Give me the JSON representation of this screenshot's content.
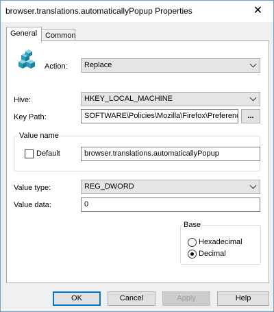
{
  "window": {
    "title": "browser.translations.automaticallyPopup Properties"
  },
  "tabs": [
    {
      "label": "General"
    },
    {
      "label": "Common"
    }
  ],
  "action": {
    "label": "Action:",
    "value": "Replace"
  },
  "hive": {
    "label": "Hive:",
    "value": "HKEY_LOCAL_MACHINE"
  },
  "key_path": {
    "label": "Key Path:",
    "value": "SOFTWARE\\Policies\\Mozilla\\Firefox\\Preferences"
  },
  "browse_button": {
    "label": "..."
  },
  "value_name": {
    "group_label": "Value name",
    "default_label": "Default",
    "value": "browser.translations.automaticallyPopup"
  },
  "value_type": {
    "label": "Value type:",
    "value": "REG_DWORD"
  },
  "value_data": {
    "label": "Value data:",
    "value": "0"
  },
  "base": {
    "group_label": "Base",
    "options": [
      {
        "label": "Hexadecimal"
      },
      {
        "label": "Decimal"
      }
    ],
    "selected": "Decimal"
  },
  "buttons": {
    "ok": "OK",
    "cancel": "Cancel",
    "apply": "Apply",
    "help": "Help"
  },
  "icons": {
    "close": "close-icon",
    "registry": "registry-cubes-icon"
  }
}
